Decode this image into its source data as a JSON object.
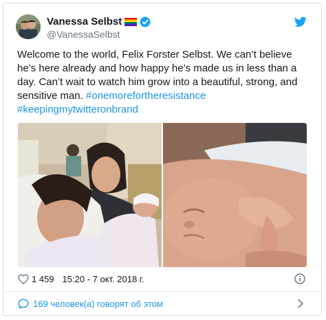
{
  "author": {
    "name": "Vanessa Selbst",
    "handle": "@VanessaSelbst",
    "avatar_icon": "avatar-photo",
    "flag_icon": "rainbow-flag-icon",
    "verified_icon": "verified-badge-icon"
  },
  "tweet": {
    "text": "Welcome to the world, Felix Forster Selbst. We can’t believe he’s here already and how happy he’s made us in less than a day. Can’t wait to watch him grow into a beautiful, strong, and sensitive man.",
    "hashtag_1": "#onemorefortheresistance",
    "hashtag_2": "#keepingmytwitteronbrand",
    "photos": [
      "mother-with-partner-and-newborn-photo",
      "sleeping-newborn-closeup-photo"
    ]
  },
  "meta": {
    "likes": "1 459",
    "timestamp": "15:20 - 7 окт. 2018 г.",
    "info_icon": "info-icon"
  },
  "footer": {
    "discussion_label": "169 человек(а) говорят об этом"
  },
  "colors": {
    "text": "#14171a",
    "secondary": "#657786",
    "link": "#1b95e0",
    "twitter_blue": "#1da1f2",
    "border": "#d3dce3"
  }
}
